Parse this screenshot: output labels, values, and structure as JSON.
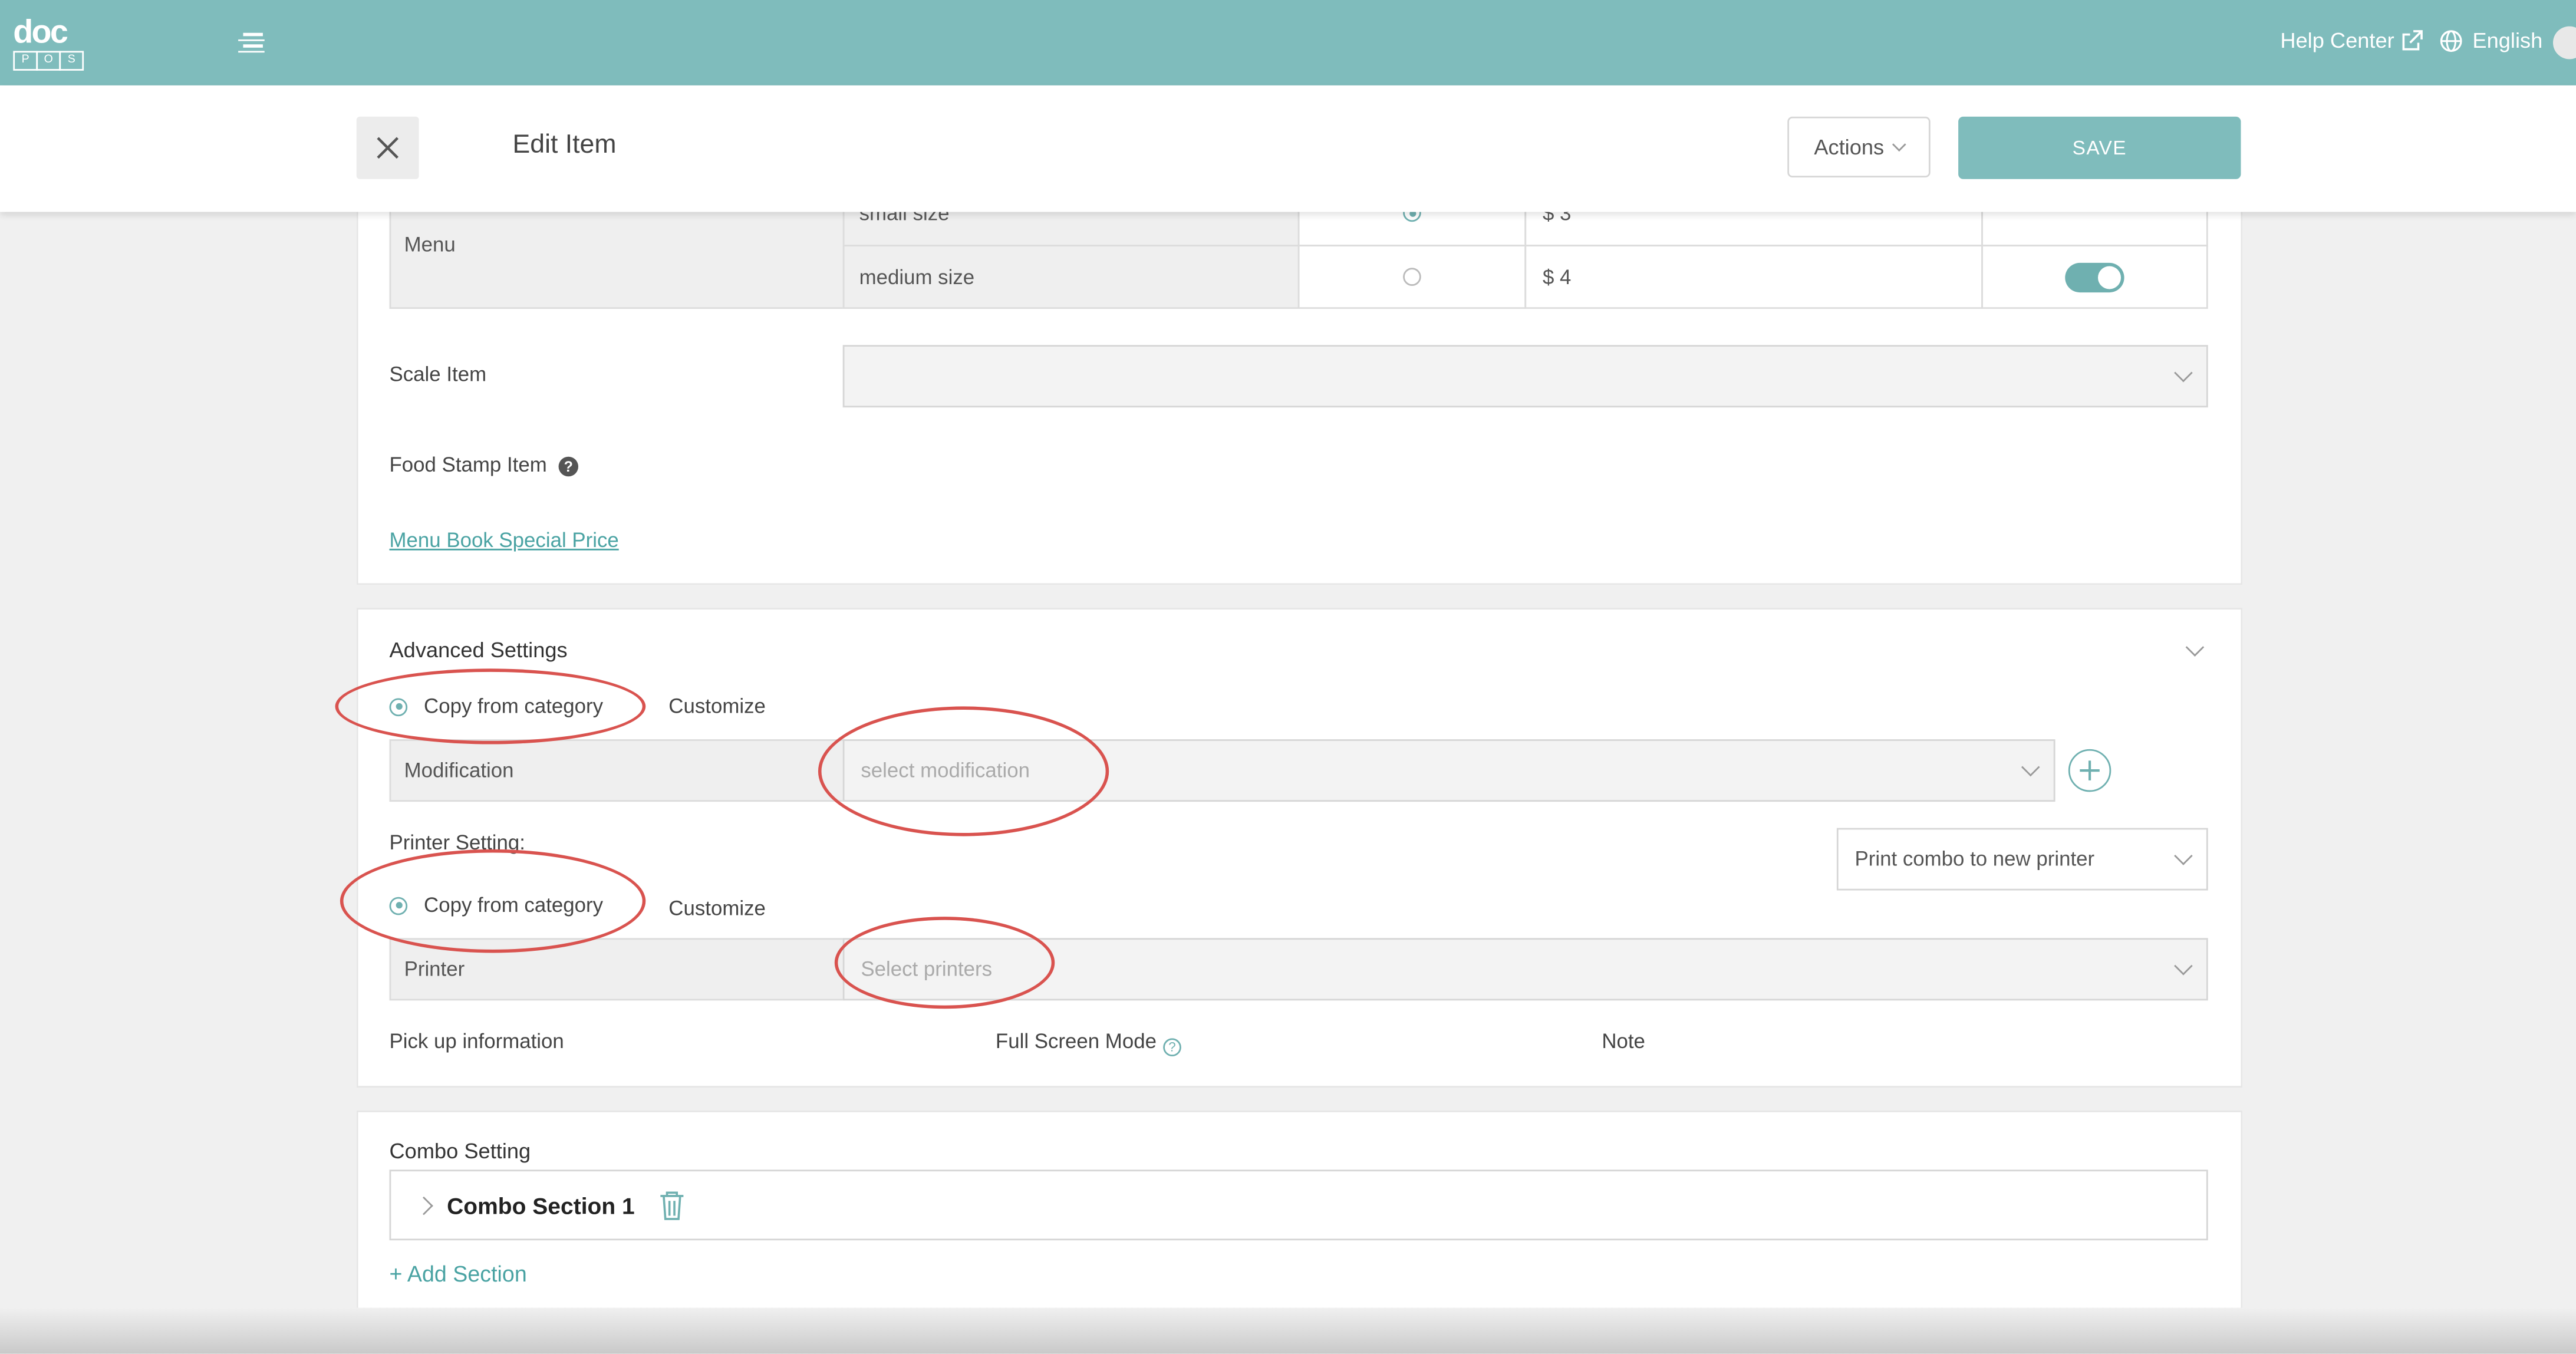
{
  "topbar": {
    "logo_main": "doc",
    "logo_letters": [
      "P",
      "O",
      "S"
    ],
    "help_label": "Help Center",
    "language_label": "English"
  },
  "header": {
    "title": "Edit Item",
    "actions_label": "Actions",
    "save_label": "SAVE"
  },
  "menu_table": {
    "row_label": "Menu",
    "rows": [
      {
        "size": "small size",
        "price": "$ 3",
        "default": true,
        "enabled": true
      },
      {
        "size": "medium size",
        "price": "$ 4",
        "default": false,
        "enabled": true
      }
    ]
  },
  "scale_item": {
    "label": "Scale Item",
    "on": false,
    "select_value": ""
  },
  "food_stamp": {
    "label": "Food Stamp Item",
    "on": false
  },
  "menu_book_link": "Menu Book Special Price",
  "advanced": {
    "title": "Advanced Settings",
    "copy_label": "Copy from category",
    "customize_label": "Customize",
    "modification_label": "Modification",
    "modification_placeholder": "select modification",
    "printer_setting_title": "Printer Setting:",
    "printer_copy_label": "Copy from category",
    "printer_customize_label": "Customize",
    "print_combo_value": "Print combo to new printer",
    "printer_label": "Printer",
    "printer_placeholder": "Select printers",
    "pickup_label": "Pick up information",
    "fullscreen_label": "Full Screen Mode",
    "note_label": "Note"
  },
  "combo": {
    "title": "Combo Setting",
    "sections": [
      {
        "name": "Combo Section 1"
      }
    ],
    "add_label": "+ Add Section"
  },
  "colors": {
    "brand": "#7fbcbc",
    "annotation": "#d9534f"
  }
}
